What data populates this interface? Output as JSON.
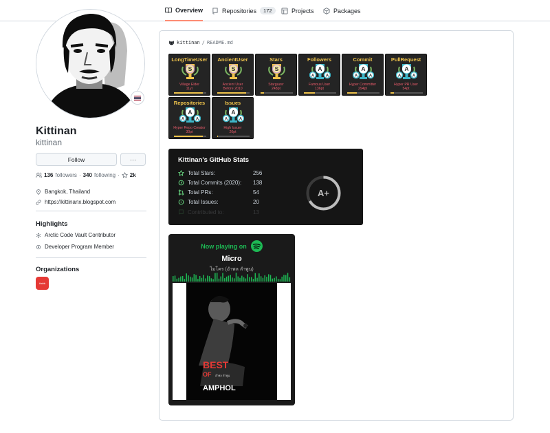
{
  "tabs": [
    {
      "label": "Overview",
      "icon": "book-icon",
      "selected": true
    },
    {
      "label": "Repositories",
      "icon": "repo-icon",
      "count": "172"
    },
    {
      "label": "Projects",
      "icon": "table-icon"
    },
    {
      "label": "Packages",
      "icon": "package-icon"
    }
  ],
  "profile": {
    "name": "Kittinan",
    "login": "kittinan",
    "follow_label": "Follow",
    "more_label": "···",
    "followers": "136",
    "followers_label": "followers",
    "following": "340",
    "following_label": "following",
    "stars": "2k",
    "location": "Bangkok, Thailand",
    "website": "https://kittinanx.blogspot.com",
    "flag": "Thailand flag"
  },
  "highlights": {
    "heading": "Highlights",
    "items": [
      "Arctic Code Vault Contributor",
      "Developer Program Member"
    ]
  },
  "organizations": {
    "heading": "Organizations",
    "logo_text": "thaibk"
  },
  "readme": {
    "owner": "kittinan",
    "separator": "/",
    "file": "README.md"
  },
  "trophies": [
    {
      "title": "LongTimeUser",
      "rank": "S",
      "status": "Village Elder",
      "value": "11yr",
      "progress": 0.9
    },
    {
      "title": "AncientUser",
      "rank": "S",
      "status": "Ancient User",
      "value": "Before 2010",
      "progress": 0.9
    },
    {
      "title": "Stars",
      "rank": "S",
      "status": "Stargazer",
      "value": "248pt",
      "progress": 0.1
    },
    {
      "title": "Followers",
      "rank": "A",
      "status": "Famous User",
      "value": "136pt",
      "progress": 0.35
    },
    {
      "title": "Commit",
      "rank": "A",
      "status": "Hyper Committer",
      "value": "294pt",
      "progress": 0.3
    },
    {
      "title": "PullRequest",
      "rank": "A",
      "status": "Hyper PR User",
      "value": "54pt",
      "progress": 0.1
    },
    {
      "title": "Repositories",
      "rank": "A",
      "status": "Hyper Repo Creator",
      "value": "30pt",
      "progress": 0.9
    },
    {
      "title": "Issues",
      "rank": "A",
      "status": "High Issuer",
      "value": "20pt",
      "progress": 0.02
    }
  ],
  "github_stats": {
    "title": "Kittinan's GitHub Stats",
    "rows": [
      {
        "label": "Total Stars:",
        "value": "256",
        "icon": "star-icon"
      },
      {
        "label": "Total Commits (2020):",
        "value": "138",
        "icon": "history-icon"
      },
      {
        "label": "Total PRs:",
        "value": "54",
        "icon": "pr-icon"
      },
      {
        "label": "Total Issues:",
        "value": "20",
        "icon": "issue-icon"
      },
      {
        "label": "Contributed to:",
        "value": "13",
        "icon": "repo-icon"
      }
    ],
    "grade": "A+"
  },
  "spotify": {
    "header": "Now playing on",
    "song": "Micro",
    "artist": "ไมโคร (อำพล ลำพูน)",
    "cover_line1": "BEST",
    "cover_line2": "OF",
    "cover_line3": "AMPHOL",
    "cover_sub": "อำพล ลำพูน"
  }
}
